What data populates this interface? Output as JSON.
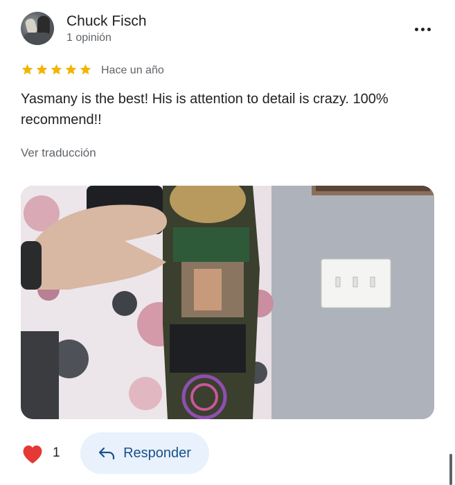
{
  "review": {
    "author_name": "Chuck Fisch",
    "author_meta": "1 opinión",
    "rating": 5,
    "rating_max": 5,
    "time_ago": "Hace un año",
    "text": "Yasmany is the best! His is attention to detail is crazy. 100% recommend!!",
    "translate_label": "Ver traducción",
    "photo_icon": "tattoo-sleeve-photo"
  },
  "actions": {
    "like_count": "1",
    "reply_label": "Responder",
    "more_icon": "more-options-icon"
  },
  "colors": {
    "star": "#f4b400",
    "heart": "#e53935",
    "reply_bg": "#e8f1fc",
    "reply_text": "#1a4f8a",
    "muted_text": "#5f6368"
  }
}
